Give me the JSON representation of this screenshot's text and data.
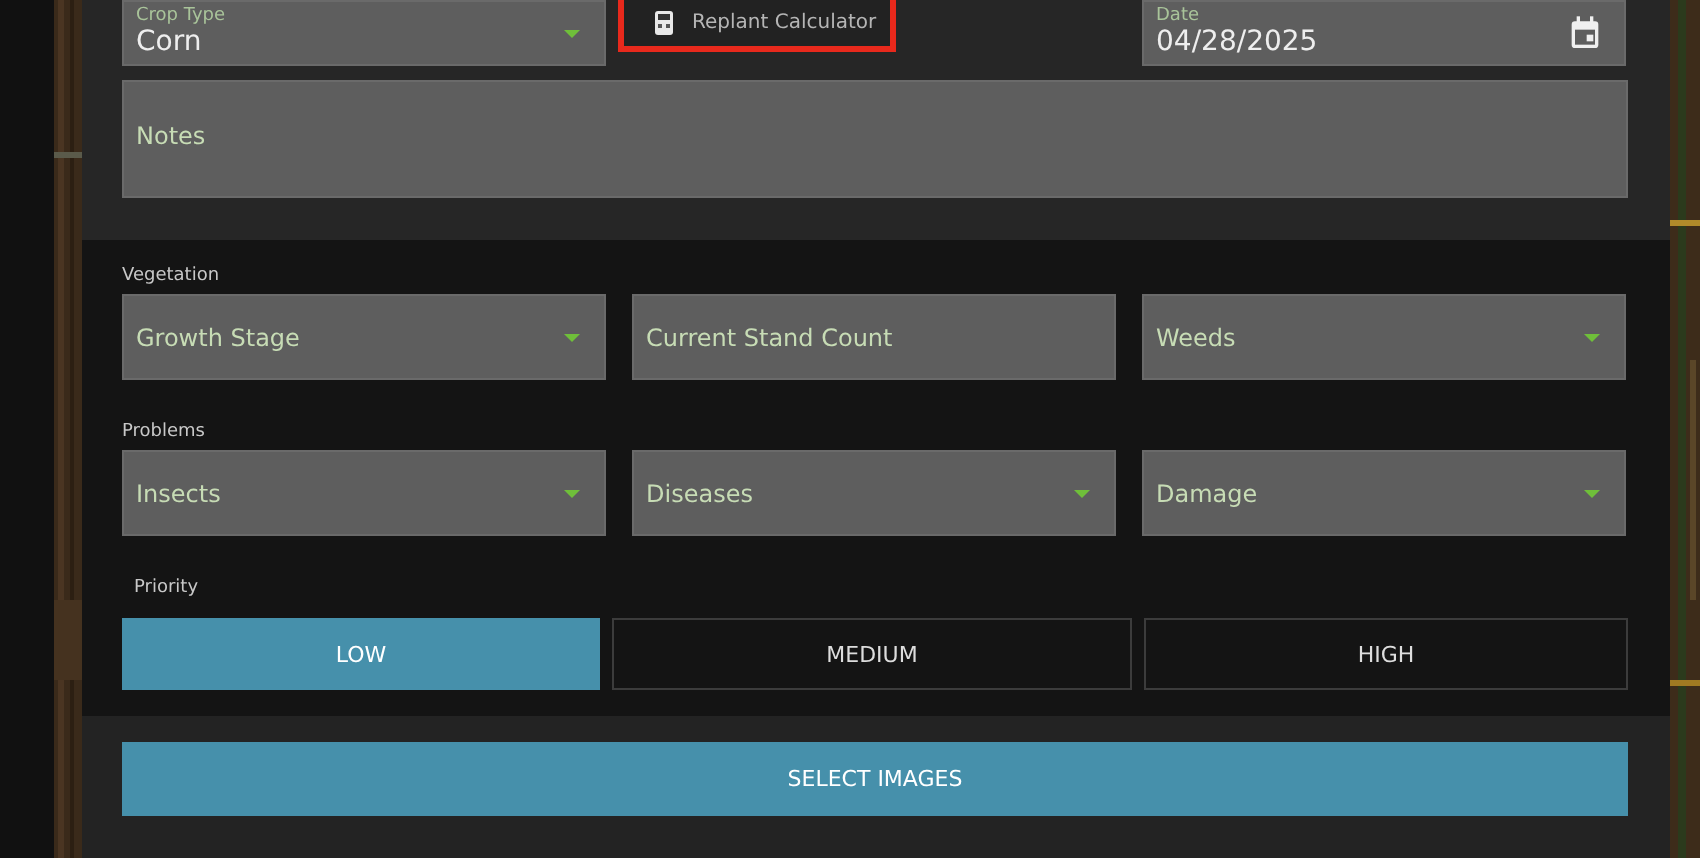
{
  "top_fields": [
    {
      "kind": "dropdown",
      "label": "Crop Type",
      "value": "Corn"
    },
    {
      "kind": "button",
      "label": "Replant Calculator"
    },
    {
      "kind": "date",
      "label": "Date",
      "value": "04/28/2025"
    }
  ],
  "notes": {
    "placeholder": "Notes"
  },
  "groups": [
    {
      "label": "Vegetation",
      "fields": [
        {
          "kind": "dropdown",
          "placeholder": "Growth Stage"
        },
        {
          "kind": "text",
          "placeholder": "Current Stand Count"
        },
        {
          "kind": "dropdown",
          "placeholder": "Weeds"
        }
      ]
    },
    {
      "label": "Problems",
      "fields": [
        {
          "kind": "dropdown",
          "placeholder": "Insects"
        },
        {
          "kind": "dropdown",
          "placeholder": "Diseases"
        },
        {
          "kind": "dropdown",
          "placeholder": "Damage"
        }
      ]
    }
  ],
  "priority": {
    "label": "Priority",
    "options": [
      {
        "label": "LOW",
        "selected": true
      },
      {
        "label": "MEDIUM",
        "selected": false
      },
      {
        "label": "HIGH",
        "selected": false
      }
    ]
  },
  "select_images": {
    "label": "SELECT IMAGES"
  }
}
